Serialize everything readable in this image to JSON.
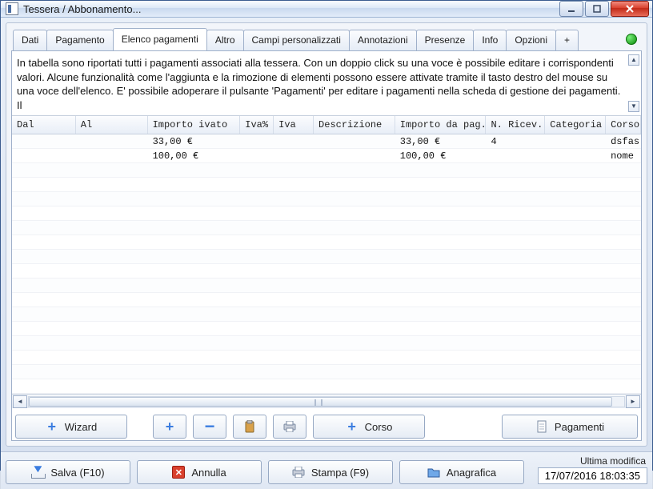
{
  "window": {
    "title": "Tessera / Abbonamento..."
  },
  "tabs": [
    "Dati",
    "Pagamento",
    "Elenco pagamenti",
    "Altro",
    "Campi personalizzati",
    "Annotazioni",
    "Presenze",
    "Info",
    "Opzioni",
    "+"
  ],
  "active_tab_index": 2,
  "help_text": "In tabella sono riportati tutti i pagamenti associati alla tessera. Con un doppio click su una voce è possibile editare i corrispondenti valori. Alcune funzionalità come l'aggiunta e la rimozione di elementi possono essere attivate tramite il tasto destro del mouse su una voce dell'elenco. E' possibile adoperare il pulsante 'Pagamenti' per editare i pagamenti nella scheda di gestione dei pagamenti. Il",
  "columns": [
    "Dal",
    "Al",
    "Importo ivato",
    "Iva%",
    "Iva",
    "Descrizione",
    "Importo da pag.",
    "N. Ricev.",
    "Categoria",
    "Corso"
  ],
  "rows": [
    {
      "dal": "",
      "al": "",
      "importo": "33,00 €",
      "ivap": "",
      "iva": "",
      "desc": "",
      "imppag": "33,00 €",
      "nric": "4",
      "cat": "",
      "corso": "dsfas",
      "selected": true
    },
    {
      "dal": "",
      "al": "",
      "importo": "100,00 €",
      "ivap": "",
      "iva": "",
      "desc": "",
      "imppag": "100,00 €",
      "nric": "",
      "cat": "",
      "corso": "nome",
      "selected": false
    }
  ],
  "buttons": {
    "wizard": "Wizard",
    "corso": "Corso",
    "pagamenti": "Pagamenti",
    "salva": "Salva (F10)",
    "annulla": "Annulla",
    "stampa": "Stampa (F9)",
    "anagrafica": "Anagrafica"
  },
  "footer": {
    "last_mod_label": "Ultima modifica",
    "timestamp": "17/07/2016 18:03:35"
  }
}
